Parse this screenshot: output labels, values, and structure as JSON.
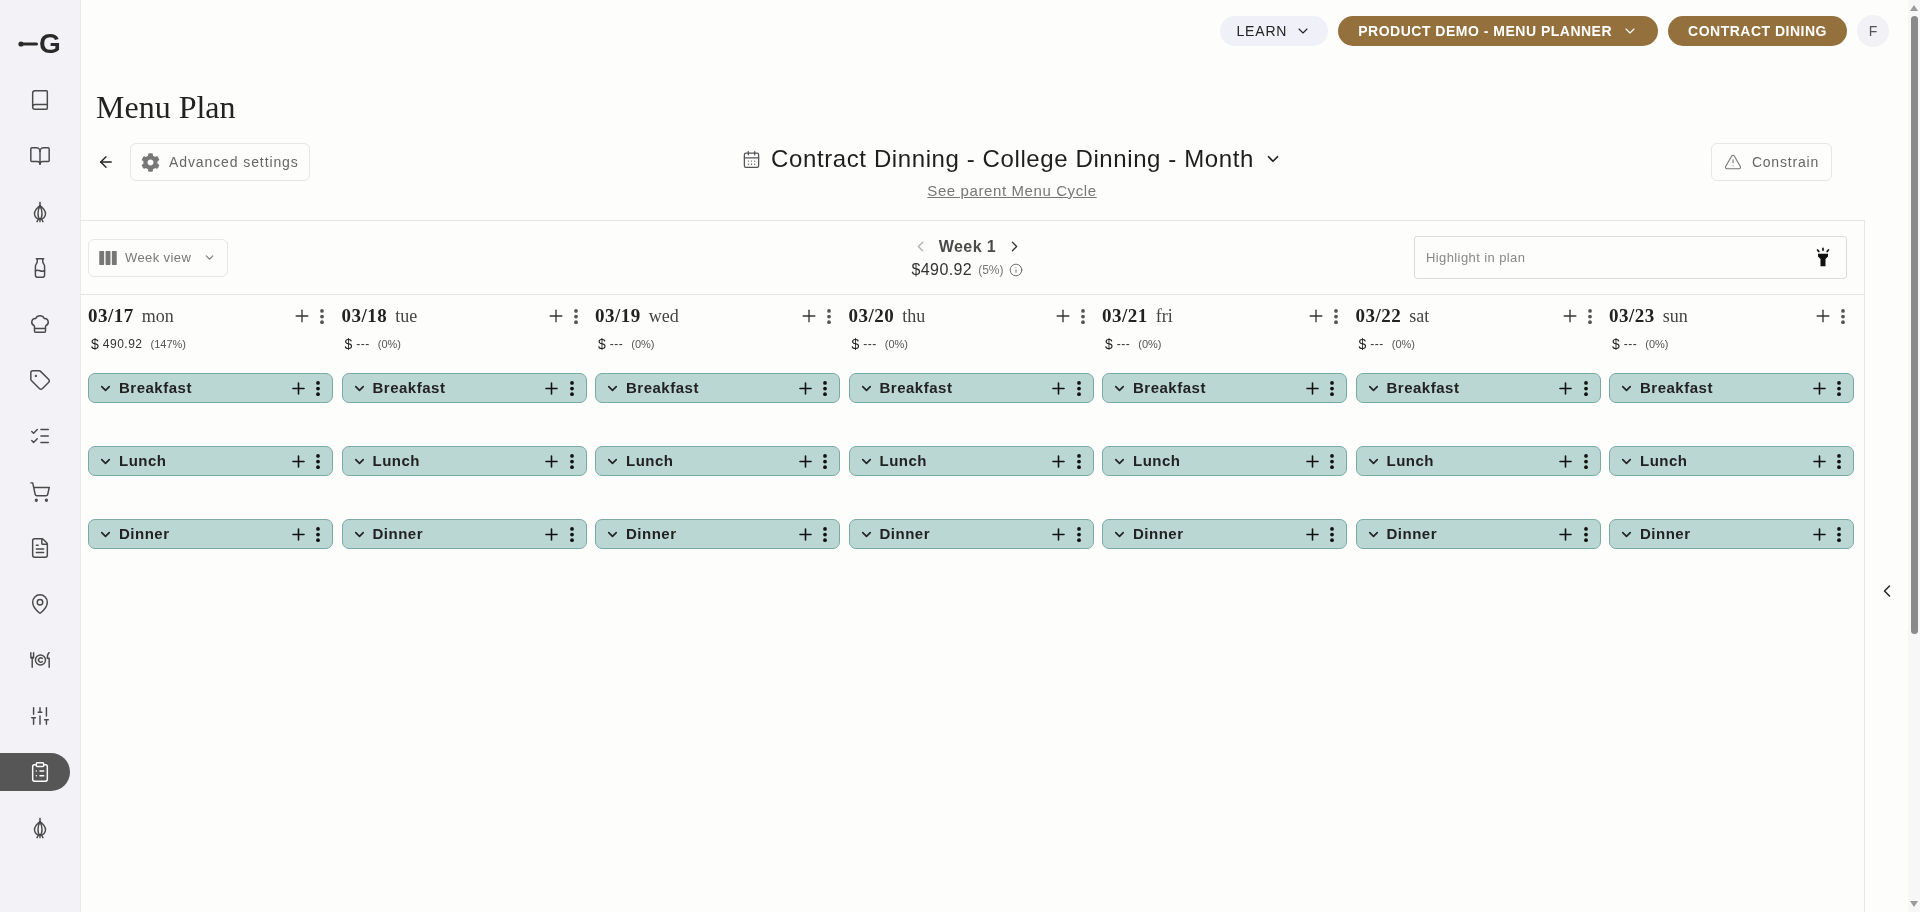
{
  "sidebar": {
    "logo": "G",
    "items": [
      {
        "selected": false
      },
      {
        "selected": false
      },
      {
        "selected": false
      },
      {
        "selected": false
      },
      {
        "selected": false
      },
      {
        "selected": false
      },
      {
        "selected": false
      },
      {
        "selected": false
      },
      {
        "selected": false
      },
      {
        "selected": false
      },
      {
        "selected": false
      },
      {
        "selected": false
      },
      {
        "selected": true
      },
      {
        "selected": false
      }
    ]
  },
  "top_bar": {
    "learn": "LEARN",
    "workspace": "PRODUCT DEMO - MENU PLANNER",
    "client": "CONTRACT DINING",
    "avatar": "F"
  },
  "header": {
    "title": "Menu Plan",
    "advanced_settings": "Advanced settings",
    "plan_name": "Contract Dinning - College Dinning - Month",
    "parent_link": "See parent Menu Cycle",
    "constrain": "Constrain"
  },
  "toolbar": {
    "view": "Week view",
    "week": "Week 1",
    "prev": {
      "disabled": true
    },
    "next": {
      "disabled": false
    },
    "week_cost": "$490.92",
    "week_share": "(5%)",
    "highlight": {
      "placeholder": "Highlight in plan"
    }
  },
  "days": [
    {
      "date": "03/17",
      "weekday": "mon",
      "currency": "$",
      "cost": "490.92",
      "share": "(147%)",
      "meals": [
        {
          "name": "Breakfast"
        },
        {
          "name": "Lunch"
        },
        {
          "name": "Dinner"
        }
      ]
    },
    {
      "date": "03/18",
      "weekday": "tue",
      "currency": "$",
      "cost": "---",
      "share": "(0%)",
      "meals": [
        {
          "name": "Breakfast"
        },
        {
          "name": "Lunch"
        },
        {
          "name": "Dinner"
        }
      ]
    },
    {
      "date": "03/19",
      "weekday": "wed",
      "currency": "$",
      "cost": "---",
      "share": "(0%)",
      "meals": [
        {
          "name": "Breakfast"
        },
        {
          "name": "Lunch"
        },
        {
          "name": "Dinner"
        }
      ]
    },
    {
      "date": "03/20",
      "weekday": "thu",
      "currency": "$",
      "cost": "---",
      "share": "(0%)",
      "meals": [
        {
          "name": "Breakfast"
        },
        {
          "name": "Lunch"
        },
        {
          "name": "Dinner"
        }
      ]
    },
    {
      "date": "03/21",
      "weekday": "fri",
      "currency": "$",
      "cost": "---",
      "share": "(0%)",
      "meals": [
        {
          "name": "Breakfast"
        },
        {
          "name": "Lunch"
        },
        {
          "name": "Dinner"
        }
      ]
    },
    {
      "date": "03/22",
      "weekday": "sat",
      "currency": "$",
      "cost": "---",
      "share": "(0%)",
      "meals": [
        {
          "name": "Breakfast"
        },
        {
          "name": "Lunch"
        },
        {
          "name": "Dinner"
        }
      ]
    },
    {
      "date": "03/23",
      "weekday": "sun",
      "currency": "$",
      "cost": "---",
      "share": "(0%)",
      "meals": [
        {
          "name": "Breakfast"
        },
        {
          "name": "Lunch"
        },
        {
          "name": "Dinner"
        }
      ]
    }
  ]
}
